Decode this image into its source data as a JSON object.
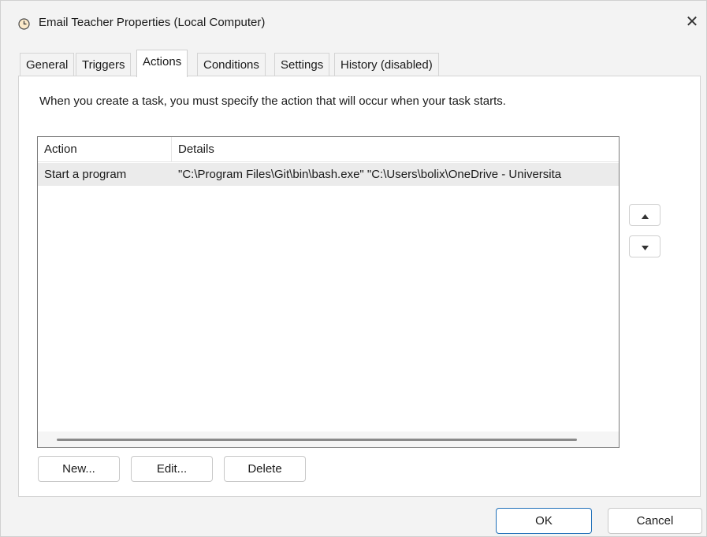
{
  "window": {
    "title": "Email Teacher Properties (Local Computer)",
    "title_icon": "clock-icon",
    "close_icon": "close-icon",
    "close_glyph": "✕"
  },
  "tabs": [
    {
      "label": "General",
      "active": false
    },
    {
      "label": "Triggers",
      "active": false
    },
    {
      "label": "Actions",
      "active": true
    },
    {
      "label": "Conditions",
      "active": false
    },
    {
      "label": "Settings",
      "active": false
    },
    {
      "label": "History (disabled)",
      "active": false
    }
  ],
  "actions_tab": {
    "instructions": "When you create a task, you must specify the action that will occur when your task starts.",
    "columns": [
      "Action",
      "Details"
    ],
    "rows": [
      {
        "action": "Start a program",
        "details": "\"C:\\Program Files\\Git\\bin\\bash.exe\" \"C:\\Users\\bolix\\OneDrive - Universita"
      }
    ],
    "move_up_icon": "triangle-up-icon",
    "move_down_icon": "triangle-down-icon",
    "buttons": {
      "new": "New...",
      "edit": "Edit...",
      "delete": "Delete"
    }
  },
  "footer": {
    "ok": "OK",
    "cancel": "Cancel"
  },
  "colors": {
    "window_bg": "#f3f3f3",
    "panel_bg": "#ffffff",
    "selected_row": "#ebebeb",
    "default_button_border": "#1f6fb8"
  }
}
